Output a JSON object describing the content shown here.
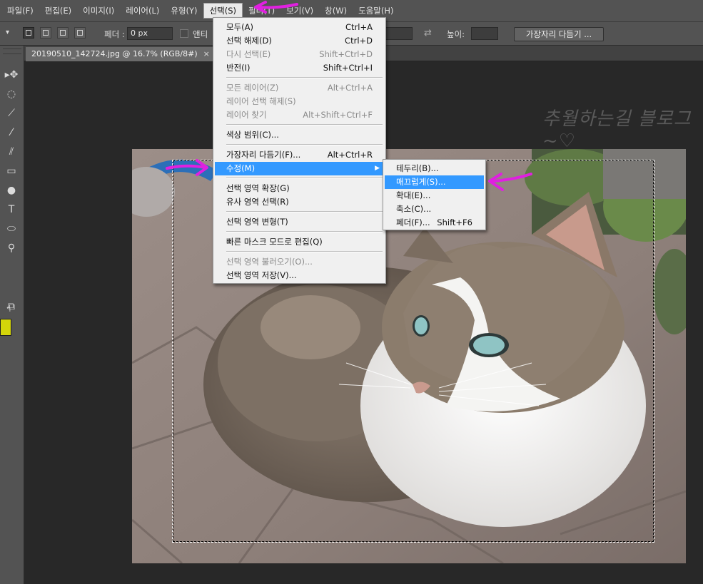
{
  "menubar": {
    "items": [
      "파일(F)",
      "편집(E)",
      "이미지(I)",
      "레이어(L)",
      "유형(Y)",
      "선택(S)",
      "필터(T)",
      "보기(V)",
      "창(W)",
      "도움말(H)"
    ],
    "active_index": 5
  },
  "options": {
    "feather_label": "페더 :",
    "feather_value": "0 px",
    "antialias_label": "앤티",
    "height_label": "높이:",
    "refine_edge_button": "가장자리 다듬기 ..."
  },
  "document": {
    "tab_title": "20190510_142724.jpg @ 16.7% (RGB/8#)",
    "close": "×"
  },
  "watermark": "추월하는길 블로그~♡",
  "select_menu": {
    "items": [
      {
        "label": "모두(A)",
        "shortcut": "Ctrl+A",
        "disabled": false
      },
      {
        "label": "선택 해제(D)",
        "shortcut": "Ctrl+D",
        "disabled": false
      },
      {
        "label": "다시 선택(E)",
        "shortcut": "Shift+Ctrl+D",
        "disabled": true
      },
      {
        "label": "반전(I)",
        "shortcut": "Shift+Ctrl+I",
        "disabled": false
      },
      {
        "label": "모든 레이어(Z)",
        "shortcut": "Alt+Ctrl+A",
        "disabled": true
      },
      {
        "label": "레이어 선택 해제(S)",
        "shortcut": "",
        "disabled": true
      },
      {
        "label": "레이어 찾기",
        "shortcut": "Alt+Shift+Ctrl+F",
        "disabled": true
      },
      {
        "label": "색상 범위(C)...",
        "shortcut": "",
        "disabled": false
      },
      {
        "label": "가장자리 다듬기(F)...",
        "shortcut": "Alt+Ctrl+R",
        "disabled": false
      },
      {
        "label": "수정(M)",
        "shortcut": "",
        "disabled": false,
        "highlighted": true
      },
      {
        "label": "선택 영역 확장(G)",
        "shortcut": "",
        "disabled": false
      },
      {
        "label": "유사 영역 선택(R)",
        "shortcut": "",
        "disabled": false
      },
      {
        "label": "선택 영역 변형(T)",
        "shortcut": "",
        "disabled": false
      },
      {
        "label": "빠른 마스크 모드로 편집(Q)",
        "shortcut": "",
        "disabled": false
      },
      {
        "label": "선택 영역 불러오기(O)...",
        "shortcut": "",
        "disabled": true
      },
      {
        "label": "선택 영역 저장(V)...",
        "shortcut": "",
        "disabled": false
      }
    ]
  },
  "modify_submenu": {
    "items": [
      {
        "label": "테두리(B)...",
        "shortcut": ""
      },
      {
        "label": "매끄럽게(S)...",
        "shortcut": "",
        "highlighted": true
      },
      {
        "label": "확대(E)...",
        "shortcut": ""
      },
      {
        "label": "축소(C)...",
        "shortcut": ""
      },
      {
        "label": "페더(F)...",
        "shortcut": "Shift+F6"
      }
    ]
  },
  "colors": {
    "annotation_arrow": "#e020e0",
    "foreground_swatch": "#d4d50a",
    "menu_highlight": "#3399ff"
  }
}
